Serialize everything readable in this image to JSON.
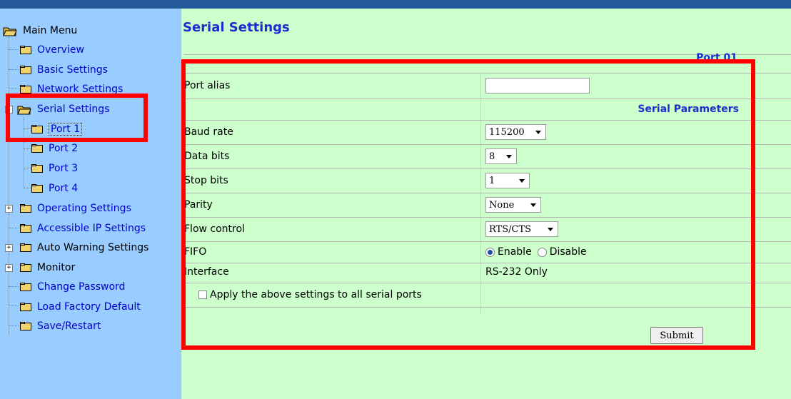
{
  "sidebar": {
    "root": "Main Menu",
    "items": [
      {
        "label": "Overview"
      },
      {
        "label": "Basic Settings"
      },
      {
        "label": "Network Settings"
      },
      {
        "label": "Serial Settings"
      },
      {
        "label": "Port 1"
      },
      {
        "label": "Port 2"
      },
      {
        "label": "Port 3"
      },
      {
        "label": "Port 4"
      },
      {
        "label": "Operating Settings"
      },
      {
        "label": "Accessible IP Settings"
      },
      {
        "label": "Auto Warning Settings"
      },
      {
        "label": "Monitor"
      },
      {
        "label": "Change Password"
      },
      {
        "label": "Load Factory Default"
      },
      {
        "label": "Save/Restart"
      }
    ]
  },
  "main": {
    "title": "Serial Settings",
    "port_header": "Port 01",
    "fields": {
      "port_alias": {
        "label": "Port alias",
        "value": ""
      },
      "section_serial": "Serial Parameters",
      "baud_rate": {
        "label": "Baud rate",
        "value": "115200"
      },
      "data_bits": {
        "label": "Data bits",
        "value": "8"
      },
      "stop_bits": {
        "label": "Stop bits",
        "value": "1"
      },
      "parity": {
        "label": "Parity",
        "value": "None"
      },
      "flow_control": {
        "label": "Flow control",
        "value": "RTS/CTS"
      },
      "fifo": {
        "label": "FIFO",
        "enable": "Enable",
        "disable": "Disable",
        "selected": "Enable"
      },
      "interface": {
        "label": "Interface",
        "value": "RS-232 Only"
      }
    },
    "apply_all_label": "Apply the above settings to all serial ports",
    "submit_label": "Submit"
  },
  "colors": {
    "topbar": "#245a9c",
    "sidebar_bg": "#99ccff",
    "main_bg": "#ccffcc",
    "link": "#0000cc",
    "title": "#1a2ecc",
    "highlight": "#ff0000"
  }
}
